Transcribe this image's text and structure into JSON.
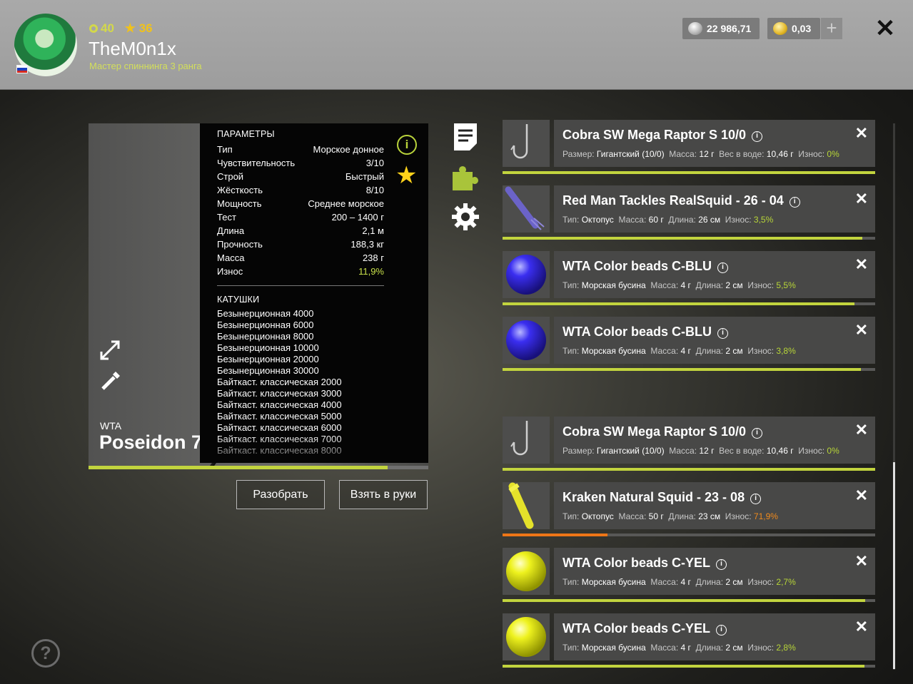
{
  "player": {
    "level": "40",
    "stars": "36",
    "name": "TheM0n1x",
    "title": "Мастер спиннинга 3 ранга",
    "flag_colors": [
      "#ffffff",
      "#1c3fbf",
      "#d52b1e"
    ]
  },
  "currency": {
    "silver": "22 986,71",
    "gold": "0,03",
    "add_label": "+"
  },
  "close_label": "✕",
  "rod": {
    "brand": "WTA",
    "name": "Poseidon 7",
    "wear_fraction": 0.88
  },
  "params": {
    "heading": "ПАРАМЕТРЫ",
    "rows": [
      {
        "k": "Тип",
        "v": "Морское донное"
      },
      {
        "k": "Чувствительность",
        "v": "3/10"
      },
      {
        "k": "Строй",
        "v": "Быстрый"
      },
      {
        "k": "Жёсткость",
        "v": "8/10"
      },
      {
        "k": "Мощность",
        "v": "Среднее морское"
      },
      {
        "k": "Тест",
        "v": "200 – 1400 г"
      },
      {
        "k": "Длина",
        "v": "2,1 м"
      },
      {
        "k": "Прочность",
        "v": "188,3 кг"
      },
      {
        "k": "Масса",
        "v": "238 г"
      },
      {
        "k": "Износ",
        "v": "11,9%"
      }
    ],
    "reels_heading": "КАТУШКИ",
    "reels": [
      "Безынерционная 4000",
      "Безынерционная 6000",
      "Безынерционная 8000",
      "Безынерционная 10000",
      "Безынерционная 20000",
      "Безынерционная 30000",
      "Байткаст. классическая 2000",
      "Байткаст. классическая 3000",
      "Байткаст. классическая 4000",
      "Байткаст. классическая 5000",
      "Байткаст. классическая 6000",
      "Байткаст. классическая 7000",
      "Байткаст. классическая 8000"
    ]
  },
  "buttons": {
    "disassemble": "Разобрать",
    "take": "Взять в руки"
  },
  "help_label": "?",
  "tackle": [
    {
      "name": "Cobra SW Mega Raptor S 10/0",
      "kind": "hook",
      "props": [
        {
          "k": "Размер:",
          "v": "Гигантский (10/0)"
        },
        {
          "k": "Масса:",
          "v": "12 г"
        },
        {
          "k": "Вес в воде:",
          "v": "10,46 г"
        }
      ],
      "wear_label": "Износ:",
      "wear": "0%",
      "wear_fraction": 1.0,
      "state": "ok"
    },
    {
      "name": "Red Man Tackles RealSquid - 26 - 04",
      "kind": "squid-blue",
      "props": [
        {
          "k": "Тип:",
          "v": "Октопус"
        },
        {
          "k": "Масса:",
          "v": "60 г"
        },
        {
          "k": "Длина:",
          "v": "26 см"
        }
      ],
      "wear_label": "Износ:",
      "wear": "3,5%",
      "wear_fraction": 0.965,
      "state": "ok"
    },
    {
      "name": "WTA Color beads C-BLU",
      "kind": "bead-blue",
      "props": [
        {
          "k": "Тип:",
          "v": "Морская бусина"
        },
        {
          "k": "Масса:",
          "v": "4 г"
        },
        {
          "k": "Длина:",
          "v": "2 см"
        }
      ],
      "wear_label": "Износ:",
      "wear": "5,5%",
      "wear_fraction": 0.945,
      "state": "ok"
    },
    {
      "name": "WTA Color beads C-BLU",
      "kind": "bead-blue",
      "props": [
        {
          "k": "Тип:",
          "v": "Морская бусина"
        },
        {
          "k": "Масса:",
          "v": "4 г"
        },
        {
          "k": "Длина:",
          "v": "2 см"
        }
      ],
      "wear_label": "Износ:",
      "wear": "3,8%",
      "wear_fraction": 0.962,
      "state": "ok"
    },
    {
      "name": "Cobra SW Mega Raptor S 10/0",
      "kind": "hook",
      "props": [
        {
          "k": "Размер:",
          "v": "Гигантский (10/0)"
        },
        {
          "k": "Масса:",
          "v": "12 г"
        },
        {
          "k": "Вес в воде:",
          "v": "10,46 г"
        }
      ],
      "wear_label": "Износ:",
      "wear": "0%",
      "wear_fraction": 1.0,
      "state": "ok"
    },
    {
      "name": "Kraken Natural Squid - 23 - 08",
      "kind": "squid-yellow",
      "props": [
        {
          "k": "Тип:",
          "v": "Октопус"
        },
        {
          "k": "Масса:",
          "v": "50 г"
        },
        {
          "k": "Длина:",
          "v": "23 см"
        }
      ],
      "wear_label": "Износ:",
      "wear": "71,9%",
      "wear_fraction": 0.281,
      "state": "worn"
    },
    {
      "name": "WTA Color beads C-YEL",
      "kind": "bead-yellow",
      "props": [
        {
          "k": "Тип:",
          "v": "Морская бусина"
        },
        {
          "k": "Масса:",
          "v": "4 г"
        },
        {
          "k": "Длина:",
          "v": "2 см"
        }
      ],
      "wear_label": "Износ:",
      "wear": "2,7%",
      "wear_fraction": 0.973,
      "state": "ok"
    },
    {
      "name": "WTA Color beads C-YEL",
      "kind": "bead-yellow",
      "props": [
        {
          "k": "Тип:",
          "v": "Морская бусина"
        },
        {
          "k": "Масса:",
          "v": "4 г"
        },
        {
          "k": "Длина:",
          "v": "2 см"
        }
      ],
      "wear_label": "Износ:",
      "wear": "2,8%",
      "wear_fraction": 0.972,
      "state": "ok"
    }
  ],
  "colors": {
    "accent_green": "#c2d43e",
    "wear_warn": "#ee7617",
    "star": "#ffd21a"
  }
}
